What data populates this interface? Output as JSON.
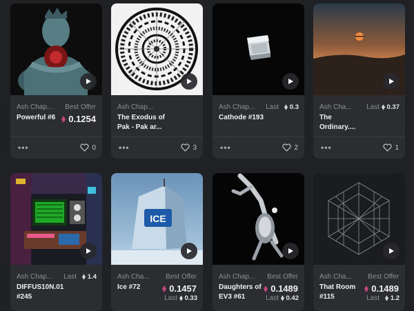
{
  "colors": {
    "background": "#202124",
    "card": "#2c2d31",
    "eth_pink": "#c4467e"
  },
  "icons": {
    "play": "play-icon",
    "more": "more-dots-icon",
    "heart": "heart-icon",
    "eth": "ethereum-icon"
  },
  "cards": [
    {
      "artist": "Ash Chap...",
      "title": "Powerful #6",
      "price_label": "Best Offer",
      "price": "0.1254",
      "more": "•••",
      "likes": "0"
    },
    {
      "artist": "Ash Chap...",
      "title": "The Exodus of Pak - Pak ar...",
      "more": "•••",
      "likes": "3"
    },
    {
      "artist": "Ash Chap...",
      "title": "Cathode #193",
      "price_label": "Last",
      "price": "0.3",
      "more": "•••",
      "likes": "2"
    },
    {
      "artist": "Ash Cha...",
      "title": "The Ordinary....",
      "price_label": "Last",
      "price": "0.37",
      "more": "•••",
      "likes": "1"
    },
    {
      "artist": "Ash Chap...",
      "title": "DIFFUS10N.01 #245",
      "price_label": "Last",
      "price": "1.4"
    },
    {
      "artist": "Ash Cha...",
      "title": "Ice #72",
      "price_label": "Best Offer",
      "price": "0.1457",
      "last_label": "Last",
      "last_price": "0.33"
    },
    {
      "artist": "Ash Chap...",
      "title": "Daughters of EV3 #61",
      "price_label": "Best Offer",
      "price": "0.1489",
      "last_label": "Last",
      "last_price": "0.42"
    },
    {
      "artist": "Ash Cha...",
      "title": "That Room #115",
      "price_label": "Best Offer",
      "price": "0.1489",
      "last_label": "Last",
      "last_price": "1.2"
    }
  ]
}
